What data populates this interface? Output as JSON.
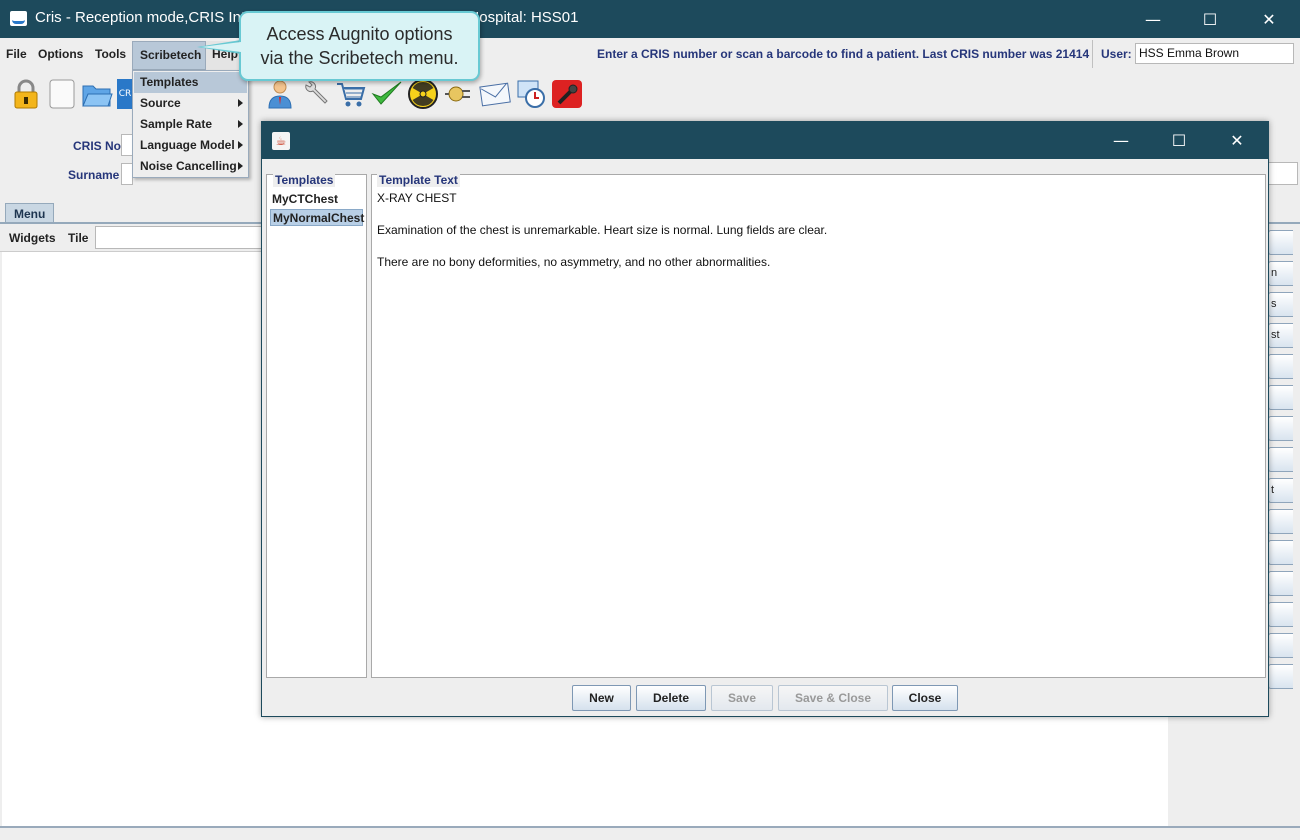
{
  "window": {
    "title": "Cris - Reception mode,CRIS Inte",
    "title_suffix": "Hospital: HSS01",
    "controls": {
      "minimize": "—",
      "maximize": "☐",
      "close": "✕"
    }
  },
  "menubar": {
    "items": [
      "File",
      "Options",
      "Tools",
      "Scribetech",
      "Help"
    ],
    "status_message": "Enter a CRIS number or scan a barcode to find a patient. Last CRIS number was 21414",
    "user_label": "User:",
    "user_value": "HSS Emma Brown"
  },
  "scribetech_menu": {
    "items": [
      {
        "label": "Templates",
        "submenu": false
      },
      {
        "label": "Source",
        "submenu": true
      },
      {
        "label": "Sample Rate",
        "submenu": true
      },
      {
        "label": "Language Model",
        "submenu": true
      },
      {
        "label": "Noise Cancelling",
        "submenu": true
      }
    ]
  },
  "callout": {
    "line1": "Access Augnito options",
    "line2": "via the Scribetech menu."
  },
  "toolbar": {
    "icons": [
      "lock-icon",
      "blank-document-icon",
      "open-folder-icon",
      "cris-icon",
      "user-icon",
      "wrench-icon",
      "shopping-cart-icon",
      "checkmark-icon",
      "radiation-icon",
      "plug-icon",
      "envelope-icon",
      "clock-icon",
      "microphone-icon"
    ],
    "cris_short": "CR"
  },
  "form": {
    "cris_no_label": "CRIS No",
    "surname_label": "Surname"
  },
  "tabs": {
    "menu_tab": "Menu",
    "widgets_label": "Widgets",
    "tile_label": "Tile"
  },
  "side_buttons": [
    "",
    "n",
    "s",
    "st",
    "",
    "",
    "",
    "",
    "t",
    "",
    "",
    "",
    "",
    "",
    ""
  ],
  "dialog": {
    "controls": {
      "minimize": "—",
      "maximize": "☐",
      "close": "✕"
    },
    "templates_title": "Templates",
    "templates": [
      "MyCTChest",
      "MyNormalChest"
    ],
    "selected_template": "MyNormalChest",
    "template_text_title": "Template Text",
    "template_lines": [
      "X-RAY CHEST",
      "",
      "Examination of the chest is unremarkable. Heart size is normal. Lung fields are clear.",
      "",
      "There are no bony deformities, no asymmetry, and no other abnormalities."
    ],
    "buttons": {
      "new": "New",
      "delete": "Delete",
      "save": "Save",
      "save_close": "Save & Close",
      "close": "Close"
    }
  }
}
